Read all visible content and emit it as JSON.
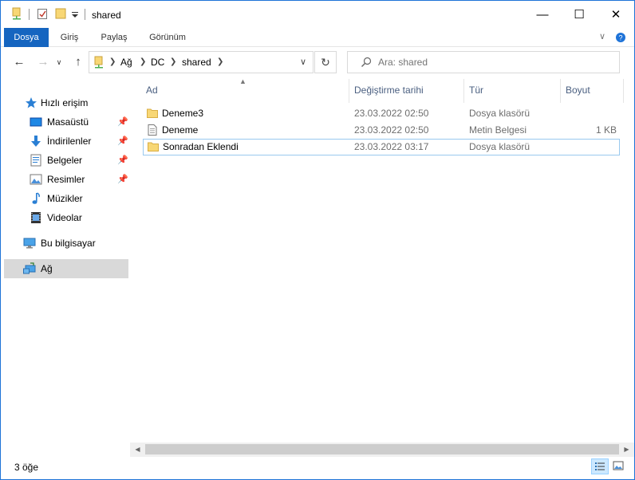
{
  "window": {
    "title": "shared",
    "controls": {
      "minimize": "—",
      "maximize": "☐",
      "close": "✕"
    }
  },
  "ribbon": {
    "tabs": [
      {
        "label": "Dosya"
      },
      {
        "label": "Giriş"
      },
      {
        "label": "Paylaş"
      },
      {
        "label": "Görünüm"
      }
    ]
  },
  "address": {
    "crumbs": [
      "Ağ",
      "DC",
      "shared"
    ]
  },
  "search": {
    "placeholder": "Ara: shared"
  },
  "navpane": {
    "quick_access": "Hızlı erişim",
    "pinned": [
      {
        "label": "Masaüstü",
        "icon": "desktop-icon"
      },
      {
        "label": "İndirilenler",
        "icon": "downloads-icon"
      },
      {
        "label": "Belgeler",
        "icon": "documents-icon"
      },
      {
        "label": "Resimler",
        "icon": "pictures-icon"
      },
      {
        "label": "Müzikler",
        "icon": "music-icon"
      },
      {
        "label": "Videolar",
        "icon": "videos-icon"
      }
    ],
    "this_pc": "Bu bilgisayar",
    "network": "Ağ"
  },
  "columns": {
    "name": "Ad",
    "modified": "Değiştirme tarihi",
    "type": "Tür",
    "size": "Boyut"
  },
  "files": [
    {
      "name": "Deneme3",
      "modified": "23.03.2022 02:50",
      "type": "Dosya klasörü",
      "size": "",
      "icon": "folder-icon"
    },
    {
      "name": "Deneme",
      "modified": "23.03.2022 02:50",
      "type": "Metin Belgesi",
      "size": "1 KB",
      "icon": "text-file-icon"
    },
    {
      "name": "Sonradan Eklendi",
      "modified": "23.03.2022 03:17",
      "type": "Dosya klasörü",
      "size": "",
      "icon": "folder-icon"
    }
  ],
  "status": {
    "item_count": "3 öğe"
  },
  "colors": {
    "accent": "#1565c0",
    "folder": "#f8d775",
    "selection_border": "#99c9ef",
    "nav_selected": "#d9d9d9",
    "window_border": "#1e73d8"
  }
}
